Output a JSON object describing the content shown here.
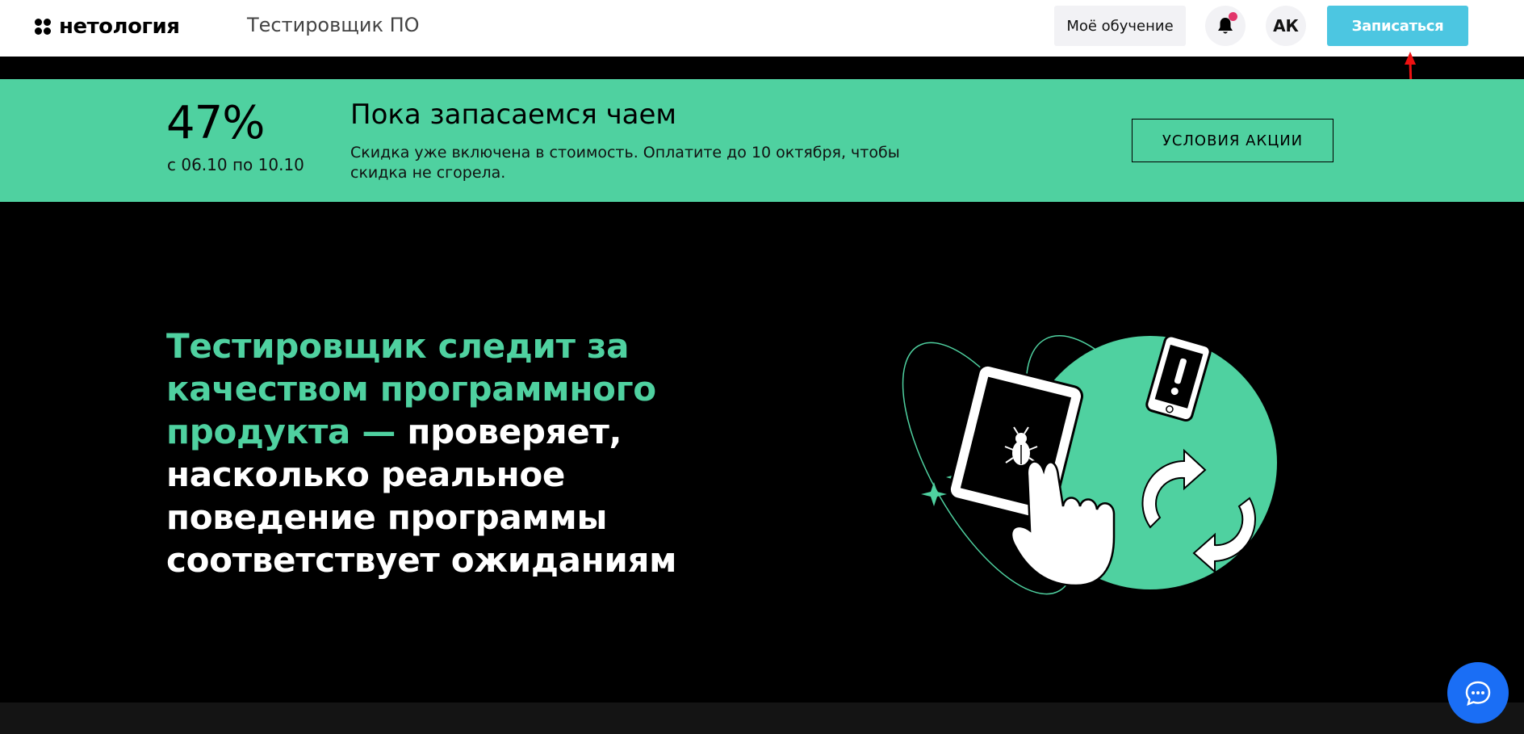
{
  "header": {
    "logo_text": "нетология",
    "course_title": "Тестировщик ПО",
    "my_learning_label": "Моё обучение",
    "avatar_initials": "АК",
    "enroll_label": "Записаться"
  },
  "promo": {
    "percent": "47%",
    "dates": "с 06.10 по 10.10",
    "title": "Пока запасаемся чаем",
    "text": "Скидка уже включена в стоимость. Оплатите до 10 октября, чтобы скидка не сгорела.",
    "button_label": "УСЛОВИЯ АКЦИИ"
  },
  "hero": {
    "accent_text": "Тестировщик следит за качеством программного продукта — ",
    "plain_text": "проверяет, насколько реальное поведение программы соответствует ожиданиям"
  },
  "colors": {
    "accent_green": "#4fd1a0",
    "enroll_blue": "#4cc6e1",
    "chat_blue": "#1a6ef5",
    "notification_dot": "#e2356a"
  },
  "icons": [
    "bell-icon",
    "chat-icon",
    "logo-icon"
  ]
}
